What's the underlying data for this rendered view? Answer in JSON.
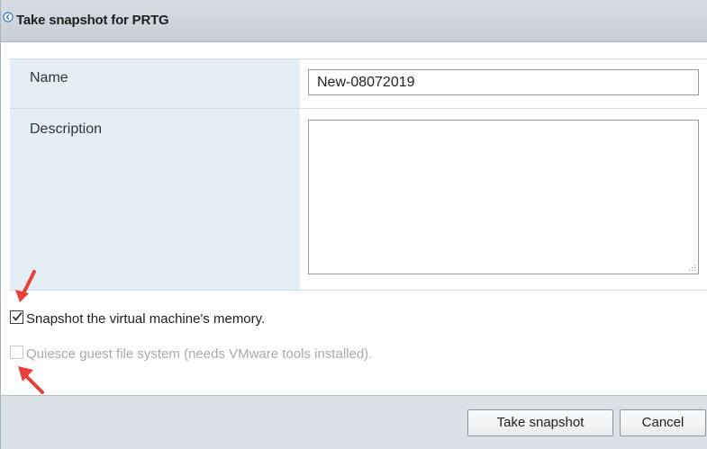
{
  "dialog": {
    "title": "Take snapshot for PRTG"
  },
  "form": {
    "name_label": "Name",
    "name_value": "New-08072019",
    "description_label": "Description",
    "description_value": ""
  },
  "options": {
    "memory_label": "Snapshot the virtual machine's memory.",
    "memory_checked": true,
    "quiesce_label": "Quiesce guest file system (needs VMware tools installed).",
    "quiesce_checked": false,
    "quiesce_disabled": true
  },
  "buttons": {
    "take_snapshot": "Take snapshot",
    "cancel": "Cancel"
  },
  "colors": {
    "annotation_arrow": "#e8413c",
    "label_column_bg": "#e3eef5",
    "footer_bg": "#dbe1e7"
  }
}
